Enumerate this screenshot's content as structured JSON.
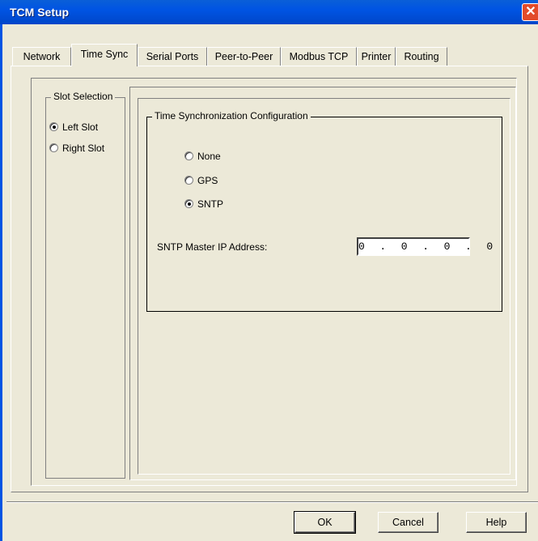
{
  "window": {
    "title": "TCM Setup",
    "close_glyph": "✕"
  },
  "tabs": [
    {
      "label": "Network"
    },
    {
      "label": "Time Sync",
      "active": true
    },
    {
      "label": "Serial Ports"
    },
    {
      "label": "Peer-to-Peer"
    },
    {
      "label": "Modbus TCP"
    },
    {
      "label": "Printer"
    },
    {
      "label": "Routing"
    }
  ],
  "slot_selection": {
    "title": "Slot Selection",
    "options": [
      {
        "label": "Left Slot",
        "checked": true
      },
      {
        "label": "Right Slot",
        "checked": false
      }
    ]
  },
  "time_sync": {
    "title": "Time Synchronization Configuration",
    "options": [
      {
        "label": "None",
        "checked": false
      },
      {
        "label": "GPS",
        "checked": false
      },
      {
        "label": "SNTP",
        "checked": true
      }
    ],
    "sntp_label": "SNTP Master IP Address:",
    "sntp_ip": "0  .  0  .  0  .  0"
  },
  "buttons": {
    "ok": "OK",
    "cancel": "Cancel",
    "help": "Help"
  }
}
